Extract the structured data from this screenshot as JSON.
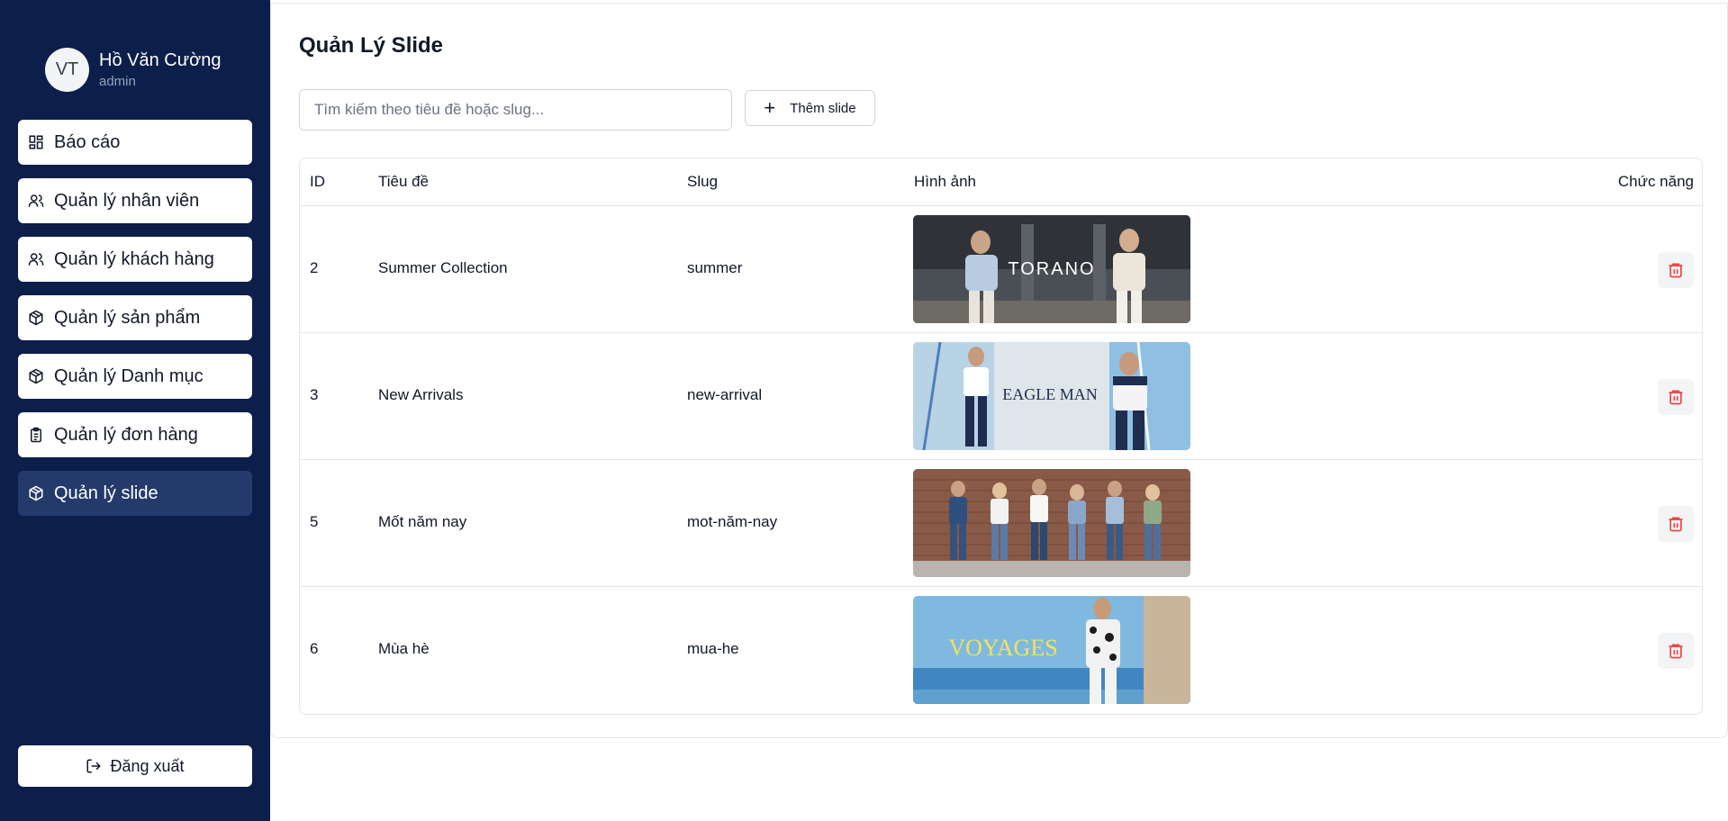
{
  "sidebar": {
    "user": {
      "initials": "VT",
      "name": "Hồ Văn Cường",
      "role": "admin"
    },
    "items": [
      {
        "label": "Báo cáo",
        "icon": "dashboard-icon"
      },
      {
        "label": "Quản lý nhân viên",
        "icon": "users-icon"
      },
      {
        "label": "Quản lý khách hàng",
        "icon": "users-icon"
      },
      {
        "label": "Quản lý sản phẩm",
        "icon": "package-icon"
      },
      {
        "label": "Quản lý Danh mục",
        "icon": "package-icon"
      },
      {
        "label": "Quản lý đơn hàng",
        "icon": "clipboard-icon"
      },
      {
        "label": "Quản lý slide",
        "icon": "package-icon",
        "active": true
      }
    ],
    "logout_label": "Đăng xuất"
  },
  "main": {
    "title": "Quản Lý Slide",
    "search": {
      "placeholder": "Tìm kiếm theo tiêu đề hoặc slug...",
      "value": ""
    },
    "add_button_label": "Thêm slide",
    "table": {
      "headers": {
        "id": "ID",
        "title": "Tiêu đề",
        "slug": "Slug",
        "image": "Hình ảnh",
        "actions": "Chức năng"
      },
      "rows": [
        {
          "id": "2",
          "title": "Summer Collection",
          "slug": "summer",
          "image_text": "TORANO"
        },
        {
          "id": "3",
          "title": "New Arrivals",
          "slug": "new-arrival",
          "image_text": "EAGLE MAN"
        },
        {
          "id": "5",
          "title": "Mốt năm nay",
          "slug": "mot-năm-nay",
          "image_text": ""
        },
        {
          "id": "6",
          "title": "Mùa hè",
          "slug": "mua-he",
          "image_text": "VOYAGES"
        }
      ]
    }
  },
  "colors": {
    "sidebar_bg": "#0c1e4a",
    "active_item_bg": "#243a6b",
    "delete_red": "#ef4444"
  }
}
